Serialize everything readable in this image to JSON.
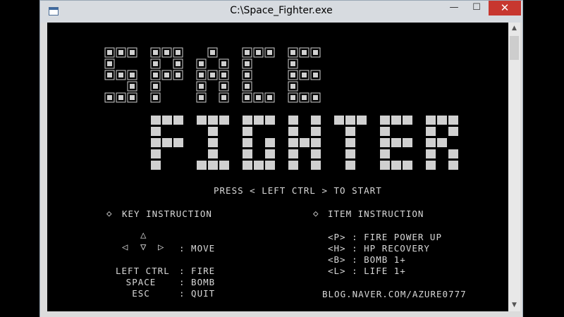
{
  "window": {
    "title": "C:\\Space_Fighter.exe",
    "minimize": "—",
    "maximize": "☐",
    "close": "✕"
  },
  "banner": {
    "line1": "SPACE",
    "line2": "FIGHTER",
    "block_color": "#d0d0d0"
  },
  "start_prompt": "PRESS < LEFT CTRL > TO START",
  "key_instruction": {
    "header": "KEY INSTRUCTION",
    "arrows": {
      "up": "△",
      "left": "◁",
      "down": "▽",
      "right": "▷"
    },
    "move_label": ": MOVE",
    "rows": [
      {
        "key": "LEFT CTRL",
        "action": ": FIRE"
      },
      {
        "key": "SPACE",
        "action": ": BOMB"
      },
      {
        "key": "ESC",
        "action": ": QUIT"
      }
    ]
  },
  "item_instruction": {
    "header": "ITEM INSTRUCTION",
    "rows": [
      "<P> : FIRE POWER UP",
      "<H> : HP RECOVERY",
      "<B> : BOMB 1+",
      "<L> : LIFE 1+"
    ]
  },
  "credit": "BLOG.NAVER.COM/AZURE0777"
}
